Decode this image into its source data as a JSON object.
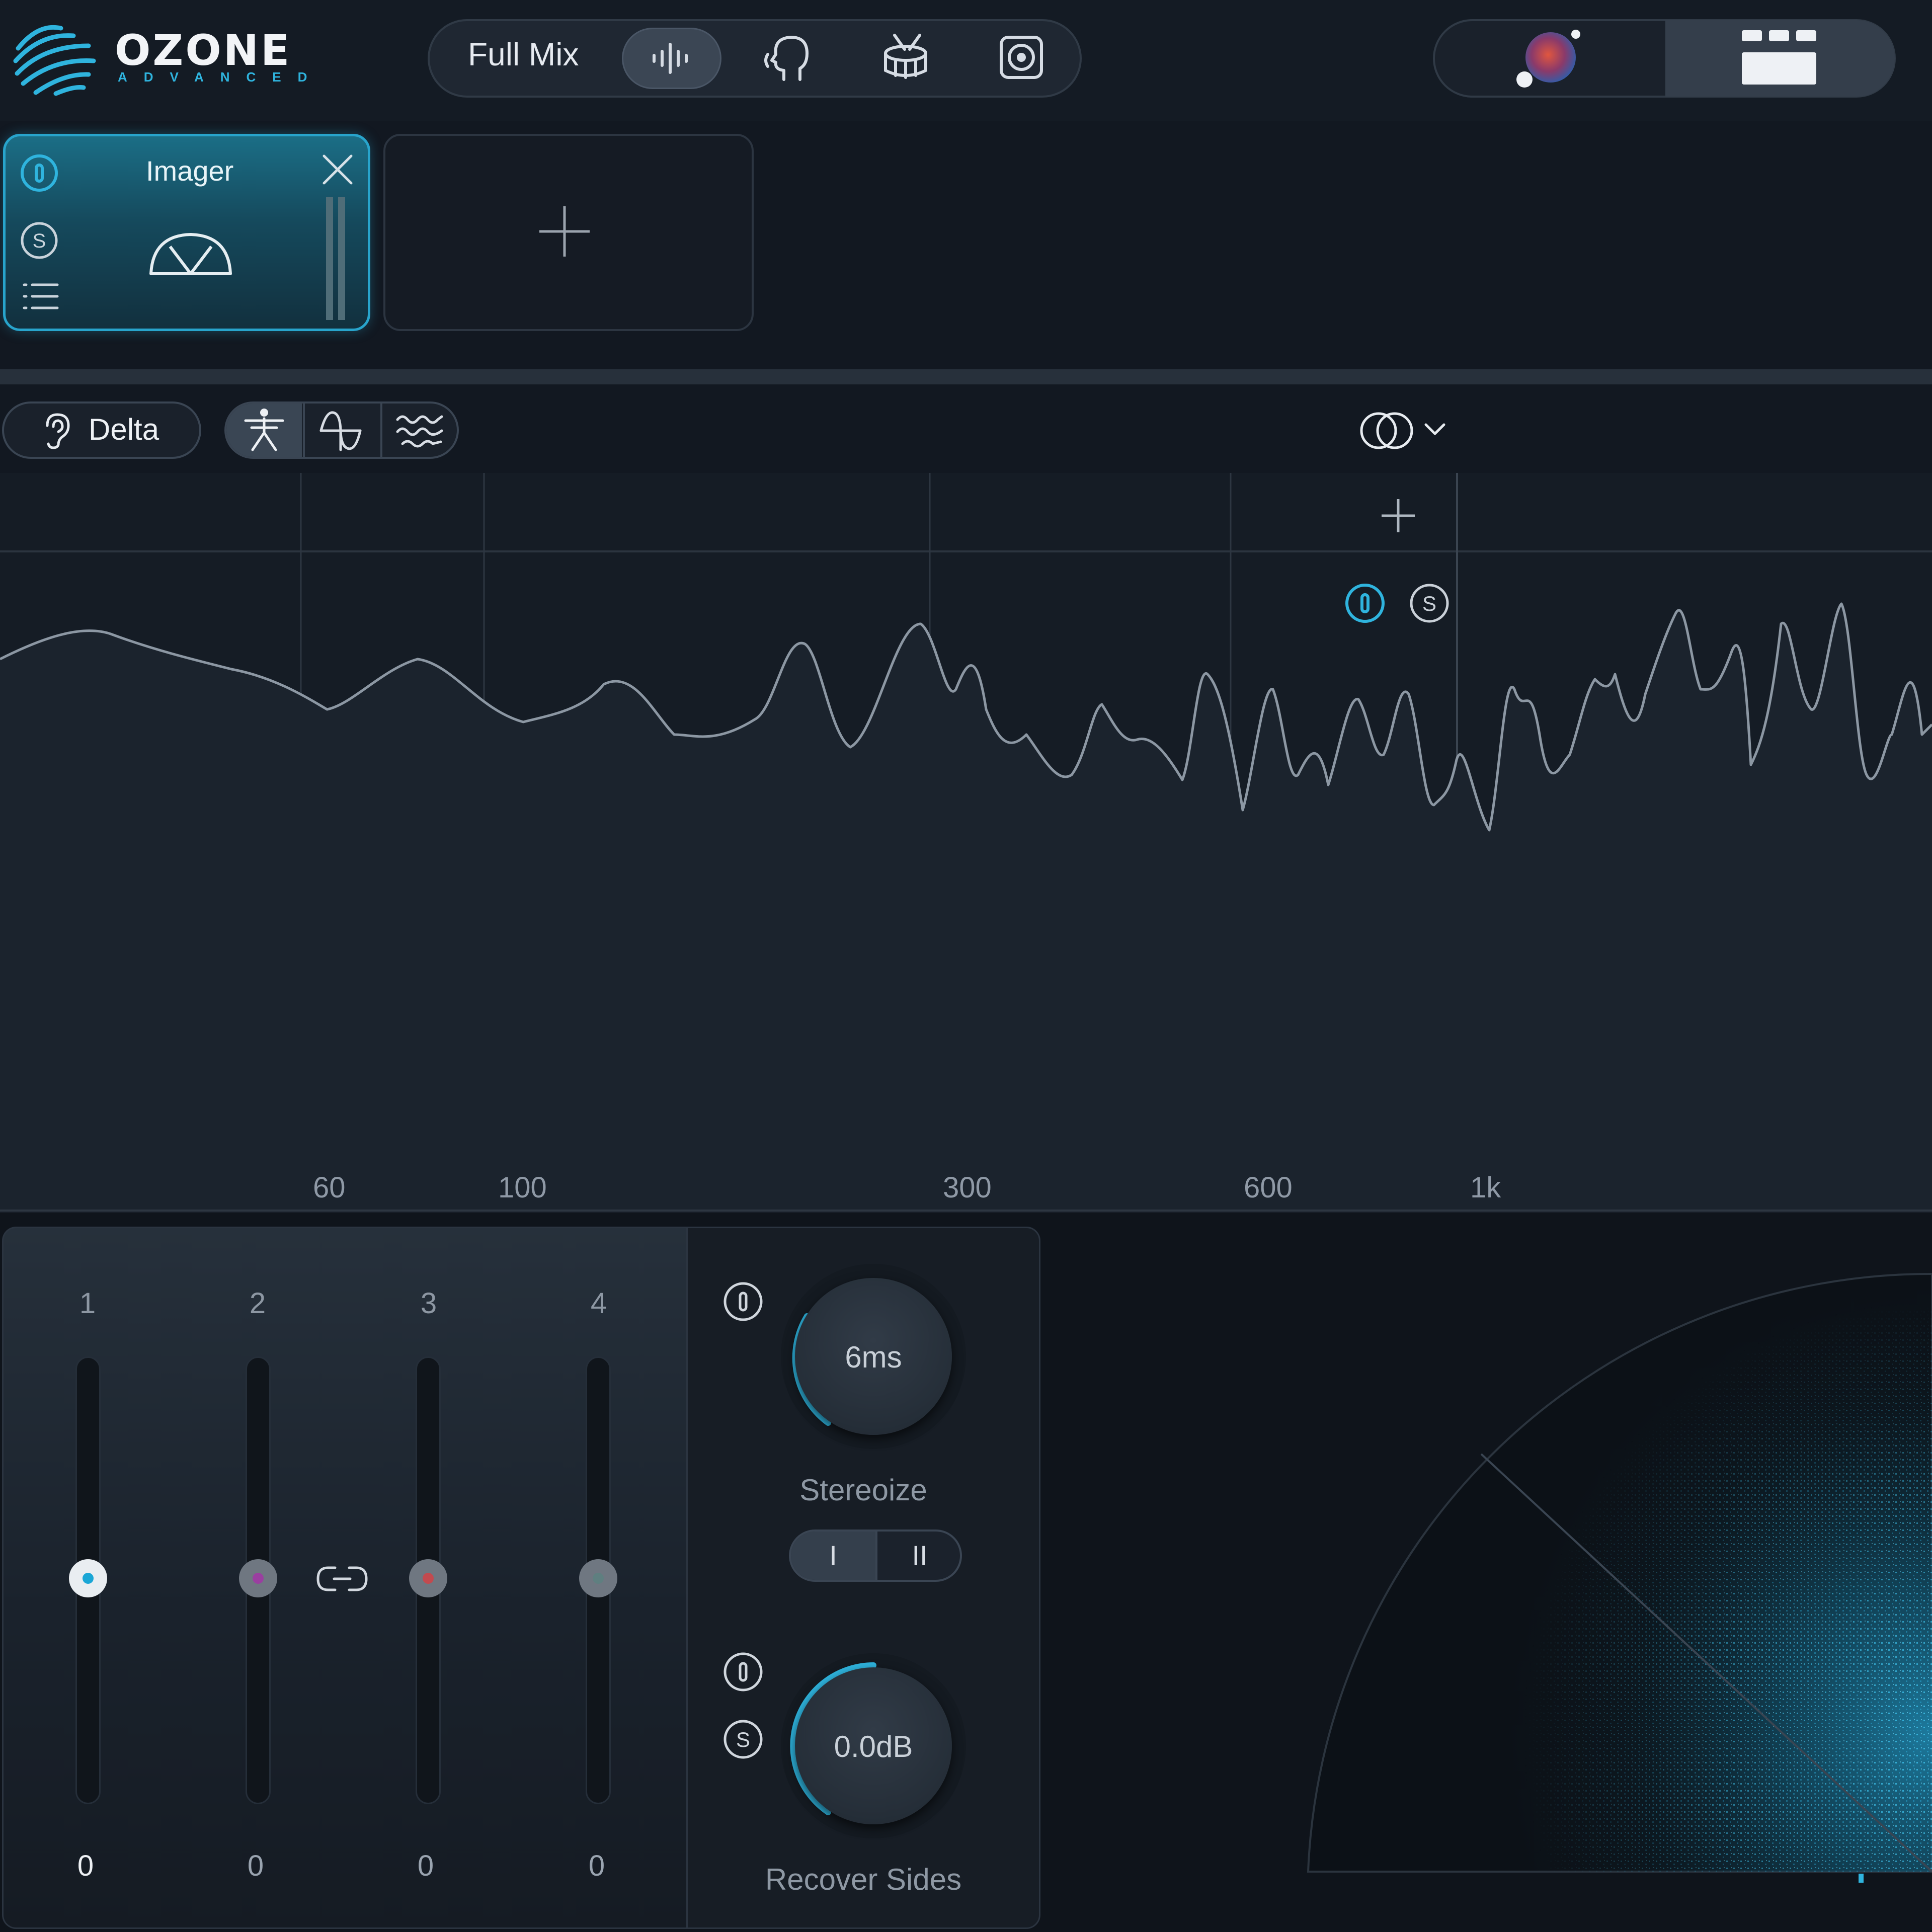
{
  "app": {
    "logo_text": "OZONE",
    "logo_subtext": "ADVANCED"
  },
  "assistant_bar": {
    "target_label": "Full Mix",
    "buttons": [
      {
        "icon": "waveform-icon",
        "active": true
      },
      {
        "icon": "vocal-head-icon",
        "active": false
      },
      {
        "icon": "drum-icon",
        "active": false
      },
      {
        "icon": "speaker-icon",
        "active": false
      }
    ]
  },
  "header_right": {
    "assistant_icon": "orb-assistant-icon",
    "view_icon": "module-grid-icon"
  },
  "module_chain": {
    "modules": [
      {
        "title": "Imager",
        "icon": "stereo-meter-icon",
        "selected": true
      }
    ],
    "add_module_icon": "plus-icon"
  },
  "analyzer_toolbar": {
    "delta_label": "Delta",
    "modes": [
      "person-icon",
      "sine-icon",
      "waves-icon"
    ],
    "active_mode": 0,
    "stereo_menu_icon": "stereo-rings-icon"
  },
  "spectrum": {
    "freq_labels": [
      "60",
      "100",
      "300",
      "600",
      "1k"
    ],
    "add_band_icon": "plus-icon"
  },
  "bands": {
    "numbers": [
      "1",
      "2",
      "3",
      "4"
    ],
    "values": [
      "0",
      "0",
      "0",
      "0"
    ],
    "thumb_colors": [
      "#1aa6d6",
      "#9a3fa0",
      "#c24a4f",
      "#5f7f80"
    ],
    "link_icon": "link-icon"
  },
  "knobs": {
    "stereoize": {
      "value": "6ms",
      "label": "Stereoize",
      "modes": [
        "I",
        "II"
      ],
      "active_mode": 0
    },
    "recover_sides": {
      "value": "0.0dB",
      "label": "Recover Sides"
    }
  },
  "colors": {
    "accent": "#2fb4de",
    "background": "#121821",
    "spectrum_line": "#8c97a3"
  }
}
